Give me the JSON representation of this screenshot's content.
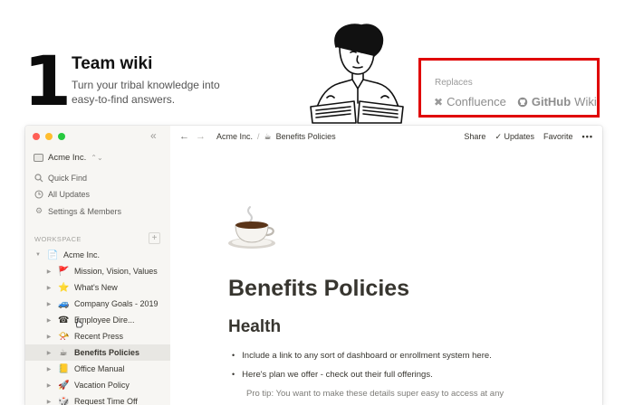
{
  "hero": {
    "number": "1",
    "title": "Team wiki",
    "subtitle": "Turn your tribal knowledge into easy-to-find answers."
  },
  "replaces": {
    "label": "Replaces",
    "items": [
      "Confluence",
      "GitHub",
      "Wiki"
    ]
  },
  "app": {
    "sidebar": {
      "workspace_name": "Acme Inc.",
      "nav": [
        {
          "label": "Quick Find",
          "icon": "search-icon"
        },
        {
          "label": "All Updates",
          "icon": "clock-icon"
        },
        {
          "label": "Settings & Members",
          "icon": "gear-icon"
        }
      ],
      "section_label": "WORKSPACE",
      "add_icon": "+",
      "collapse_icon": "«",
      "tree": [
        {
          "label": "Acme Inc.",
          "emoji": "📄",
          "level": 0
        },
        {
          "label": "Mission, Vision, Values",
          "emoji": "🚩",
          "level": 1
        },
        {
          "label": "What's New",
          "emoji": "⭐",
          "level": 1
        },
        {
          "label": "Company Goals - 2019",
          "emoji": "🚙",
          "level": 1
        },
        {
          "label": "Employee Dire...",
          "emoji": "☎",
          "level": 1
        },
        {
          "label": "Recent Press",
          "emoji": "📯",
          "level": 1
        },
        {
          "label": "Benefits Policies",
          "emoji": "☕",
          "level": 1,
          "active": true
        },
        {
          "label": "Office Manual",
          "emoji": "📒",
          "level": 1
        },
        {
          "label": "Vacation Policy",
          "emoji": "🚀",
          "level": 1
        },
        {
          "label": "Request Time Off",
          "emoji": "🎲",
          "level": 1
        }
      ]
    },
    "topbar": {
      "breadcrumb": [
        "Acme Inc.",
        "Benefits Policies"
      ],
      "breadcrumb_emoji": "☕",
      "share": "Share",
      "updates": "Updates",
      "updates_check": "✓",
      "favorite": "Favorite",
      "more": "•••"
    },
    "page": {
      "title": "Benefits Policies",
      "heading": "Health",
      "bullets": [
        "Include a link to any sort of dashboard or enrollment system here.",
        "Here's plan we offer - check out their full offerings."
      ],
      "tip": "Pro tip: You want to make these details super easy to access at any"
    }
  },
  "colors": {
    "highlight_border": "#e00000",
    "sidebar_bg": "#f7f6f3",
    "active_row": "#e8e7e3",
    "text": "#37352f"
  }
}
